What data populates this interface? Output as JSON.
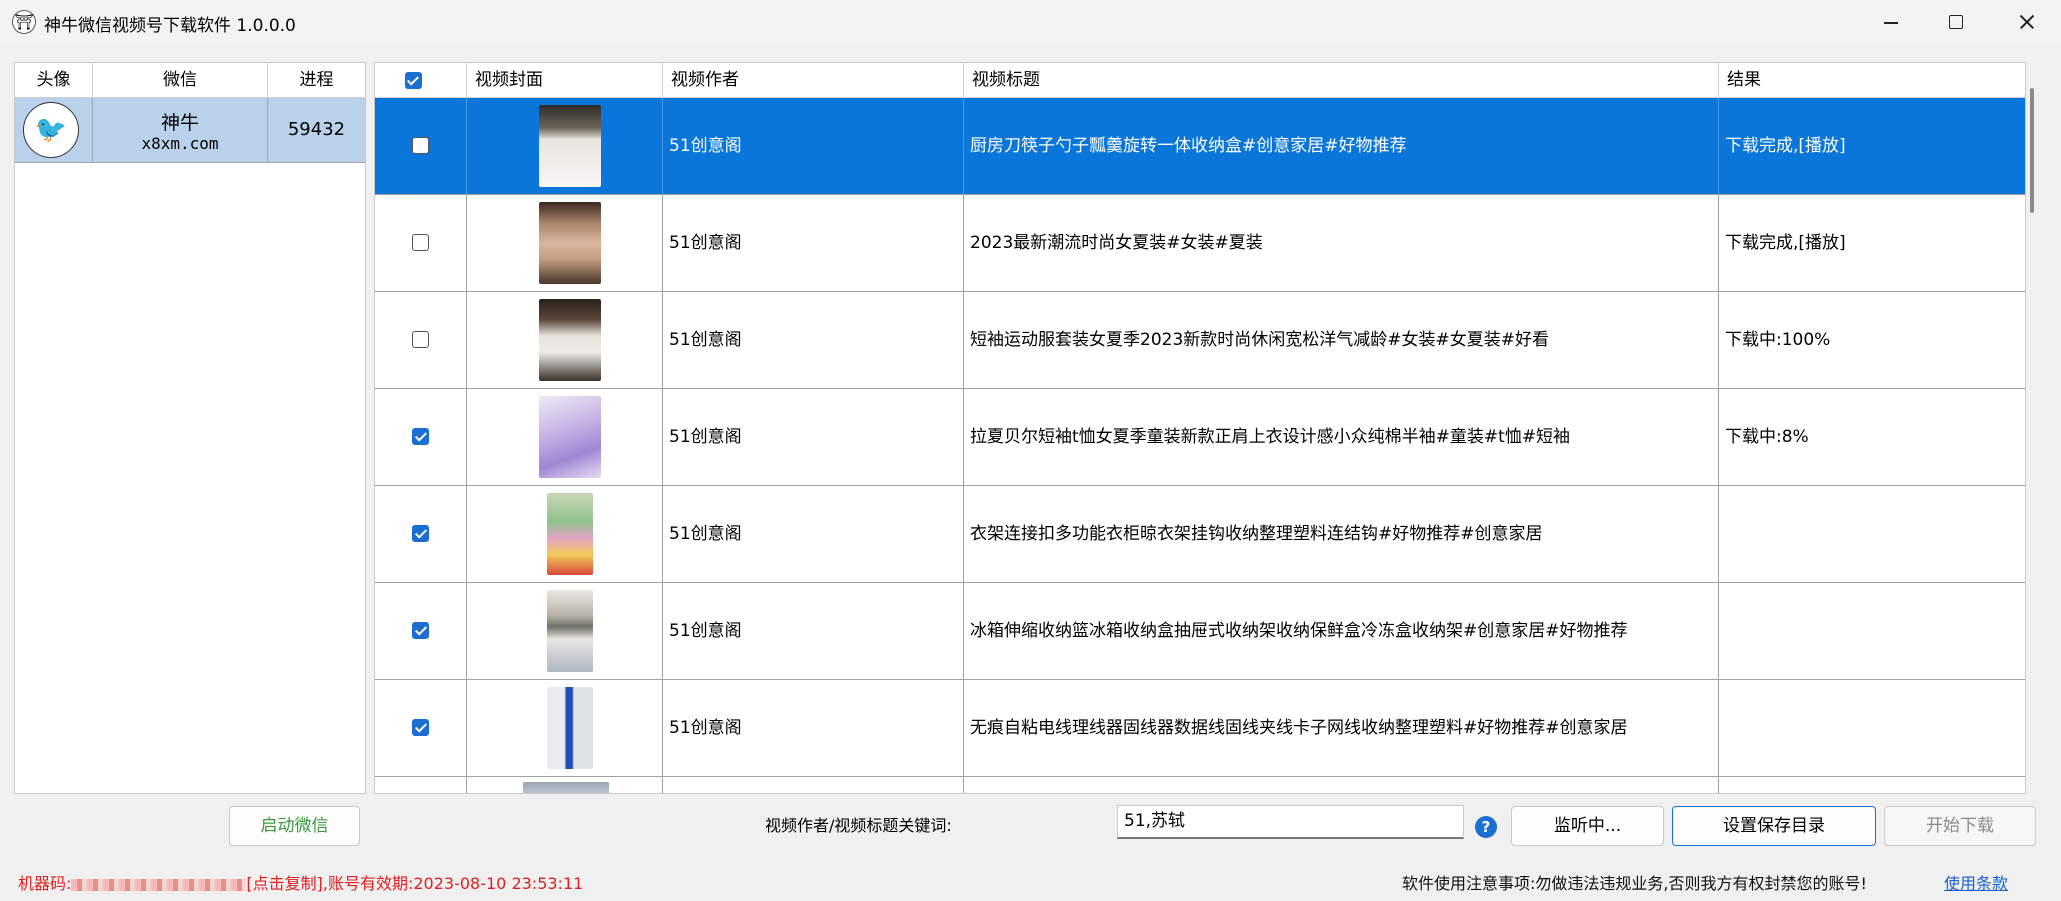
{
  "window": {
    "title": "神牛微信视频号下载软件 1.0.0.0"
  },
  "accounts": {
    "columns": [
      "头像",
      "微信",
      "进程"
    ],
    "rows": [
      {
        "name": "神牛",
        "id": "x8xm.com",
        "process": "59432"
      }
    ]
  },
  "videos": {
    "columns": [
      "视频封面",
      "视频作者",
      "视频标题",
      "结果"
    ],
    "rows": [
      {
        "checked": false,
        "selected": true,
        "author": "51创意阁",
        "title": "厨房刀筷子勺子瓢羹旋转一体收纳盒#创意家居#好物推荐",
        "result": "下载完成,[播放]"
      },
      {
        "checked": false,
        "selected": false,
        "author": "51创意阁",
        "title": "2023最新潮流时尚女夏装#女装#夏装",
        "result": "下载完成,[播放]"
      },
      {
        "checked": false,
        "selected": false,
        "author": "51创意阁",
        "title": "短袖运动服套装女夏季2023新款时尚休闲宽松洋气减龄#女装#女夏装#好看",
        "result": "下载中:100%"
      },
      {
        "checked": true,
        "selected": false,
        "author": "51创意阁",
        "title": "拉夏贝尔短袖t恤女夏季童装新款正肩上衣设计感小众纯棉半袖#童装#t恤#短袖",
        "result": "下载中:8%"
      },
      {
        "checked": true,
        "selected": false,
        "author": "51创意阁",
        "title": "衣架连接扣多功能衣柜晾衣架挂钩收纳整理塑料连结钩#好物推荐#创意家居",
        "result": ""
      },
      {
        "checked": true,
        "selected": false,
        "author": "51创意阁",
        "title": "冰箱伸缩收纳篮冰箱收纳盒抽屉式收纳架收纳保鲜盒冷冻盒收纳架#创意家居#好物推荐",
        "result": ""
      },
      {
        "checked": true,
        "selected": false,
        "author": "51创意阁",
        "title": "无痕自粘电线理线器固线器数据线固线夹线卡子网线收纳整理塑料#好物推荐#创意家居",
        "result": ""
      }
    ]
  },
  "controls": {
    "launch_label": "启动微信",
    "keyword_label": "视频作者/视频标题关键词:",
    "keyword_value": "51,苏轼",
    "listen_label": "监听中...",
    "save_dir_label": "设置保存目录",
    "start_label": "开始下载"
  },
  "status": {
    "machine_prefix": "机器码:",
    "machine_suffix": "[点击复制],账号有效期:2023-08-10 23:53:11",
    "notice": "软件使用注意事项:勿做违法违规业务,否则我方有权封禁您的账号!",
    "terms_link": "使用条款"
  }
}
